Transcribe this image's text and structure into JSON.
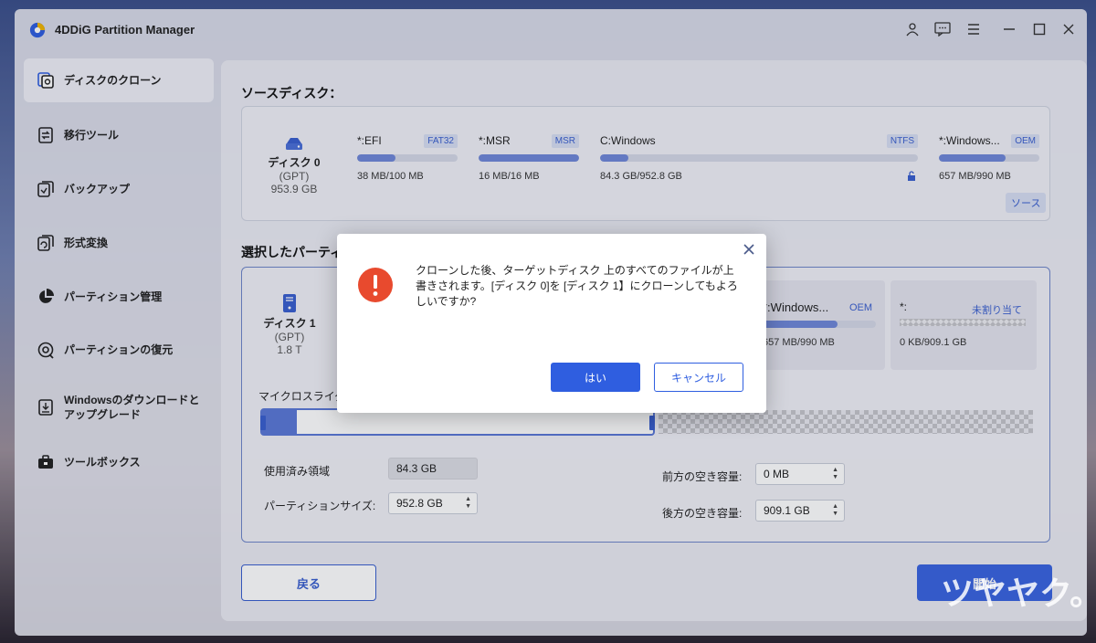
{
  "app": {
    "title": "4DDiG Partition Manager"
  },
  "sidebar": {
    "items": [
      {
        "label": "ディスクのクローン",
        "icon": "disk-clone-icon"
      },
      {
        "label": "移行ツール",
        "icon": "migration-icon"
      },
      {
        "label": "バックアップ",
        "icon": "backup-icon"
      },
      {
        "label": "形式変換",
        "icon": "convert-icon"
      },
      {
        "label": "パーティション管理",
        "icon": "pie-chart-icon"
      },
      {
        "label": "パーティションの復元",
        "icon": "recovery-icon"
      },
      {
        "label": "Windowsのダウンロードと\nアップグレード",
        "icon": "windows-download-icon"
      },
      {
        "label": "ツールボックス",
        "icon": "toolbox-icon"
      }
    ]
  },
  "source": {
    "title": "ソースディスク：",
    "disk": {
      "name": "ディスク 0",
      "scheme": "(GPT)",
      "size": "953.9 GB"
    },
    "partitions": [
      {
        "name": "*:EFI",
        "fs": "FAT32",
        "size": "38 MB/100 MB",
        "used": 0.38
      },
      {
        "name": "*:MSR",
        "fs": "MSR",
        "size": "16 MB/16 MB",
        "used": 1.0
      },
      {
        "name": "C:Windows",
        "fs": "NTFS",
        "size": "84.3 GB/952.8 GB",
        "used": 0.09
      },
      {
        "name": "*:Windows...",
        "fs": "OEM",
        "size": "657 MB/990 MB",
        "used": 0.66
      }
    ],
    "source_tag": "ソース"
  },
  "target": {
    "title": "選択したパーティ",
    "disk": {
      "name": "ディスク 1",
      "scheme": "(GPT)",
      "size": "1.8 T"
    },
    "partitions": [
      {
        "name": "*:Windows...",
        "fs": "OEM",
        "size": "657 MB/990 MB",
        "used": 0.66
      },
      {
        "name": "*:",
        "fs": "未割り当て",
        "size": "0 KB/909.1 GB"
      }
    ],
    "slider_label": "マイクロスライダ",
    "used_label": "使用済み領域",
    "used_value": "84.3 GB",
    "partition_size_label": "パーティションサイズ:",
    "partition_size_value": "952.8  GB",
    "free_before_label": "前方の空き容量:",
    "free_before_value": "0   MB",
    "free_after_label": "後方の空き容量:",
    "free_after_value": "909.1   GB"
  },
  "buttons": {
    "back": "戻る",
    "start": "開始"
  },
  "dialog": {
    "message": "クローンした後、ターゲットディスク 上のすべてのファイルが上書きされます。[ディスク 0]を [ディスク 1】にクローンしてもよろしいですか?",
    "yes": "はい",
    "cancel": "キャンセル"
  },
  "watermark": "ツヤヤク。",
  "colors": {
    "accent": "#3a5fcf",
    "danger": "#e84a2e"
  }
}
